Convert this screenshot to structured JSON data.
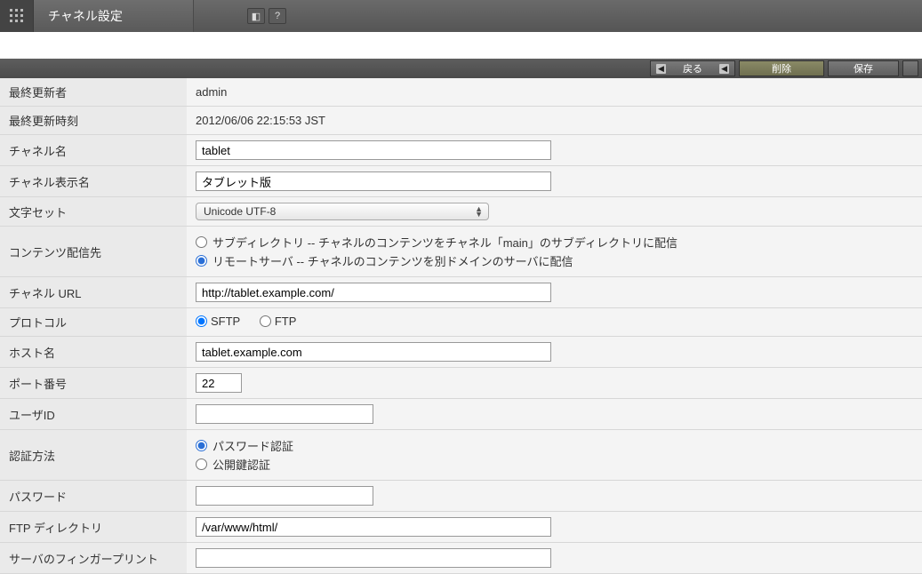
{
  "header": {
    "title": "チャネル設定"
  },
  "actions": {
    "back": "戻る",
    "delete": "削除",
    "save": "保存"
  },
  "labels": {
    "last_modified_by": "最終更新者",
    "last_modified_at": "最終更新時刻",
    "channel_name": "チャネル名",
    "channel_display_name": "チャネル表示名",
    "charset": "文字セット",
    "content_target": "コンテンツ配信先",
    "channel_url": "チャネル URL",
    "protocol": "プロトコル",
    "host": "ホスト名",
    "port": "ポート番号",
    "user_id": "ユーザID",
    "auth_method": "認証方法",
    "password": "パスワード",
    "ftp_dir": "FTP ディレクトリ",
    "fingerprint": "サーバのフィンガープリント"
  },
  "values": {
    "last_modified_by": "admin",
    "last_modified_at": "2012/06/06 22:15:53 JST",
    "channel_name": "tablet",
    "channel_display_name": "タブレット版",
    "charset": "Unicode UTF-8",
    "channel_url": "http://tablet.example.com/",
    "host": "tablet.example.com",
    "port": "22",
    "user_id": "",
    "password": "",
    "ftp_dir": "/var/www/html/",
    "fingerprint": ""
  },
  "options": {
    "content_target": {
      "subdir": "サブディレクトリ -- チャネルのコンテンツをチャネル「main」のサブディレクトリに配信",
      "remote": "リモートサーバ -- チャネルのコンテンツを別ドメインのサーバに配信",
      "selected": "remote"
    },
    "protocol": {
      "sftp": "SFTP",
      "ftp": "FTP",
      "selected": "sftp"
    },
    "auth_method": {
      "password": "パスワード認証",
      "publickey": "公開鍵認証",
      "selected": "password"
    }
  }
}
